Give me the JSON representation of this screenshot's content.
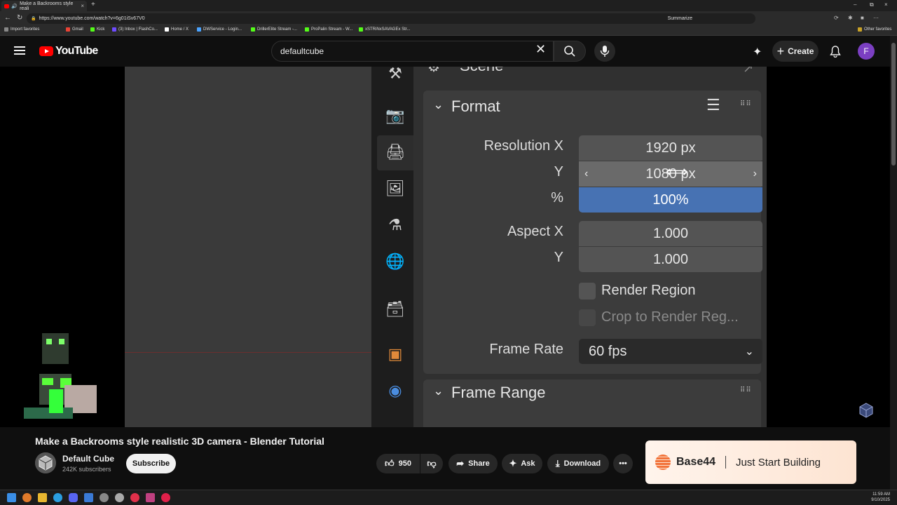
{
  "browser": {
    "tab_title": "Make a Backrooms style reali",
    "url": "https://www.youtube.com/watch?v=6g01iSv67V0",
    "summarize_label": "Summarize",
    "bookmarks": [
      {
        "label": "Import favorites",
        "color": "#cccccc"
      },
      {
        "label": "Gmail",
        "color": "#ea4335"
      },
      {
        "label": "Kick",
        "color": "#53fc18"
      },
      {
        "label": "(3) Inbox | FlashCo...",
        "color": "#6e4bff"
      },
      {
        "label": "Home / X",
        "color": "#ffffff"
      },
      {
        "label": "DWService - Login...",
        "color": "#4aa3ff"
      },
      {
        "label": "DrillerElite Stream -...",
        "color": "#53fc18"
      },
      {
        "label": "ProPalin Stream - W...",
        "color": "#53fc18"
      },
      {
        "label": "xSTRiNxSAVAGEx Str...",
        "color": "#53fc18"
      }
    ],
    "other_favorites": "Other favorites"
  },
  "youtube": {
    "logo_text": "YouTube",
    "search_value": "defaultcube",
    "create_label": "Create",
    "avatar_letter": "F"
  },
  "blender": {
    "scene_label": "Scene",
    "format_title": "Format",
    "resolution_x_label": "Resolution X",
    "resolution_x_value": "1920 px",
    "y_label": "Y",
    "resolution_y_value": "1080 px",
    "percent_label": "%",
    "percent_value": "100%",
    "aspect_x_label": "Aspect X",
    "aspect_x_value": "1.000",
    "aspect_y_label": "Y",
    "aspect_y_value": "1.000",
    "render_region_label": "Render Region",
    "crop_label": "Crop to Render Reg...",
    "frame_rate_label": "Frame Rate",
    "frame_rate_value": "60 fps",
    "frame_range_title": "Frame Range"
  },
  "video": {
    "title": "Make a Backrooms style realistic 3D camera - Blender Tutorial",
    "channel_name": "Default Cube",
    "subscribers": "242K subscribers",
    "subscribe_label": "Subscribe",
    "likes": "950",
    "share_label": "Share",
    "ask_label": "Ask",
    "download_label": "Download"
  },
  "ad": {
    "brand": "Base44",
    "tagline": "Just Start Building"
  },
  "taskbar": {
    "time": "11:59 AM",
    "date": "9/10/2025"
  },
  "colors": {
    "youtube_red": "#ff0000",
    "blender_blue": "#4772b3",
    "avatar_purple": "#7b3fc2"
  }
}
